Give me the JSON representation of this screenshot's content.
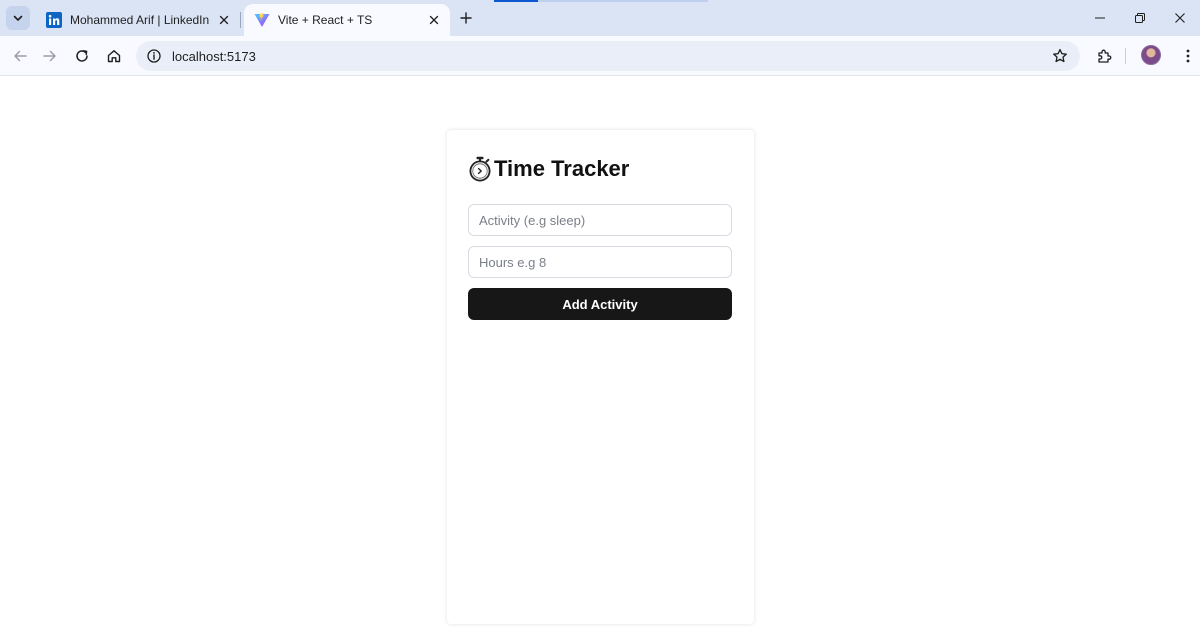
{
  "browser": {
    "tabs": [
      {
        "title": "Mohammed Arif | LinkedIn",
        "active": false,
        "favicon": "linkedin-icon"
      },
      {
        "title": "Vite + React + TS",
        "active": true,
        "favicon": "vite-icon"
      }
    ],
    "url": "localhost:5173"
  },
  "app": {
    "title": "Time Tracker",
    "title_icon": "stopwatch-icon",
    "activity_placeholder": "Activity (e.g sleep)",
    "hours_placeholder": "Hours e.g 8",
    "add_button_label": "Add Activity"
  },
  "colors": {
    "tabstrip": "#dae4f5",
    "toolbar": "#f8faff",
    "button_bg": "#171717",
    "button_text": "#ffffff",
    "linkedin": "#0a66c2"
  }
}
